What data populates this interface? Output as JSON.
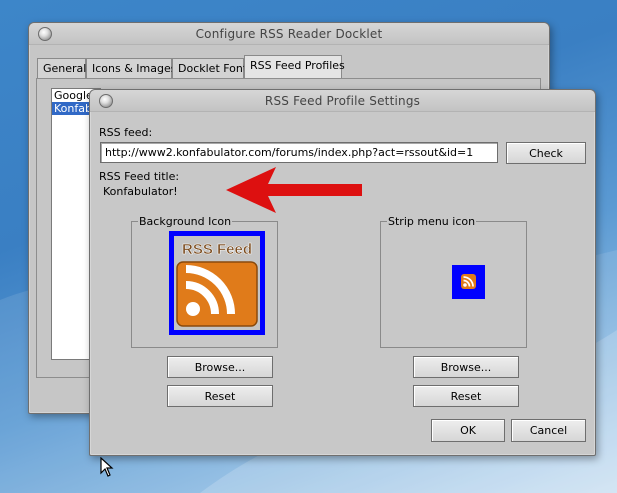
{
  "outer_window": {
    "title": "Configure RSS Reader Docklet",
    "tabs": [
      {
        "label": "General"
      },
      {
        "label": "Icons & Images"
      },
      {
        "label": "Docklet Font"
      },
      {
        "label": "RSS Feed Profiles",
        "active": true
      }
    ],
    "profiles_list": [
      "Google",
      "Konfab"
    ],
    "selected_profile_index": 1
  },
  "dialog": {
    "title": "RSS Feed Profile Settings",
    "rss_feed_label": "RSS feed:",
    "rss_feed_value": "http://www2.konfabulator.com/forums/index.php?act=rssout&id=1",
    "check_label": "Check",
    "feed_title_label": "RSS Feed title:",
    "feed_title_value": "Konfabulator!",
    "background_icon": {
      "legend": "Background Icon",
      "image_text": "RSS Feed",
      "browse_label": "Browse...",
      "reset_label": "Reset"
    },
    "strip_icon": {
      "legend": "Strip menu icon",
      "browse_label": "Browse...",
      "reset_label": "Reset"
    },
    "ok_label": "OK",
    "cancel_label": "Cancel"
  },
  "colors": {
    "window_bg": "#c6c6c6",
    "selection": "#3169c6",
    "icon_backdrop": "#0000ff",
    "rss_orange": "#e07b1a",
    "annotation_arrow": "#dd1010"
  },
  "icons": {
    "pointer": "arrow-cursor-icon",
    "annotation": "red-arrow-icon",
    "rss": "rss-feed-icon"
  }
}
